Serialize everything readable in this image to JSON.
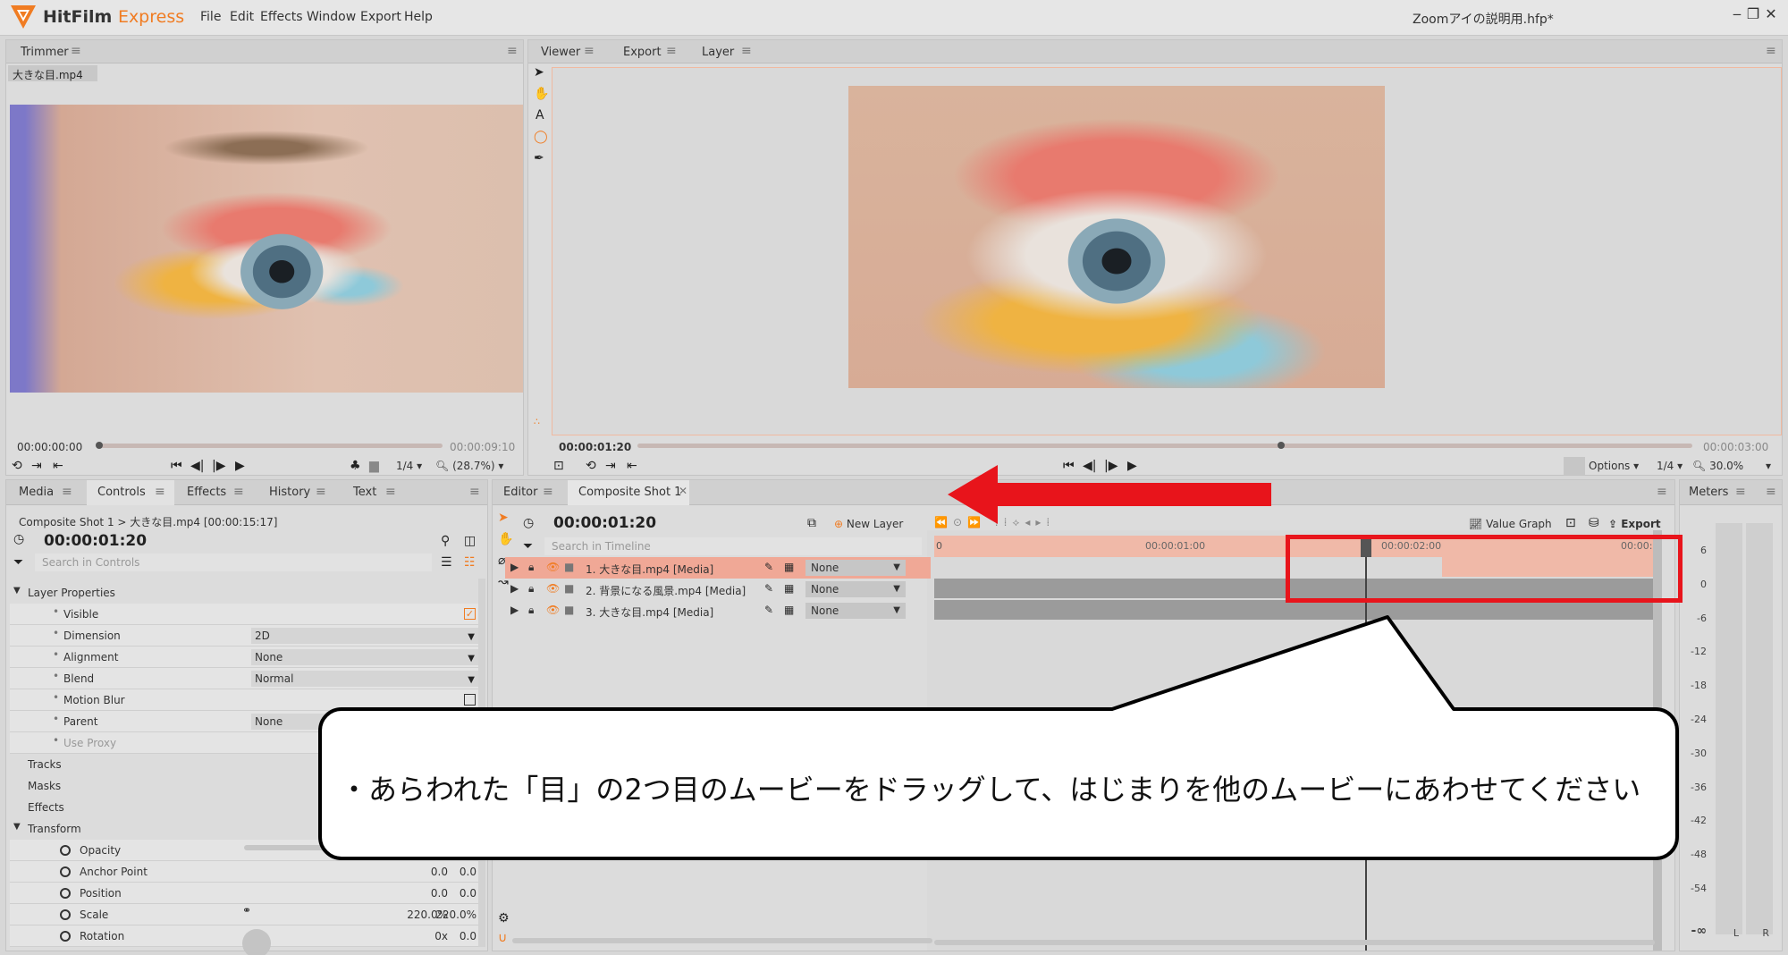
{
  "app": {
    "name": "HitFilm",
    "name_suffix": "Express",
    "file": "Zoomアイの説明用.hfp*"
  },
  "menu": [
    "File",
    "Edit",
    "Effects",
    "Window",
    "Export",
    "Help"
  ],
  "trimmer": {
    "tab": "Trimmer",
    "clip_tab": "大きな目.mp4",
    "time_current": "00:00:00:00",
    "time_end": "00:00:09:10",
    "resolution": "1/4",
    "zoom": "(28.7%)"
  },
  "viewer": {
    "tabs": [
      "Viewer",
      "Export",
      "Layer"
    ],
    "time_current": "00:00:01:20",
    "time_end": "00:00:03:00",
    "options": "Options",
    "resolution": "1/4",
    "zoom": "30.0%"
  },
  "left_panel": {
    "tabs": [
      "Media",
      "Controls",
      "Effects",
      "History",
      "Text"
    ],
    "breadcrumb": "Composite Shot 1 > 大きな目.mp4 [00:00:15:17]",
    "time": "00:00:01:20",
    "search_placeholder": "Search in Controls",
    "layer_properties_label": "Layer Properties",
    "properties": [
      {
        "label": "Visible",
        "value": "",
        "kind": "checkbox-on"
      },
      {
        "label": "Dimension",
        "value": "2D",
        "kind": "dropdown"
      },
      {
        "label": "Alignment",
        "value": "None",
        "kind": "dropdown"
      },
      {
        "label": "Blend",
        "value": "Normal",
        "kind": "dropdown"
      },
      {
        "label": "Motion Blur",
        "value": "",
        "kind": "checkbox-off"
      },
      {
        "label": "Parent",
        "value": "None",
        "kind": "dropdown"
      },
      {
        "label": "Use Proxy",
        "value": "",
        "kind": "disabled"
      }
    ],
    "sections": [
      "Tracks",
      "Masks",
      "Effects"
    ],
    "transform_label": "Transform",
    "transform": [
      {
        "label": "Opacity",
        "v1": "",
        "v2": ""
      },
      {
        "label": "Anchor Point",
        "v1": "0.0",
        "v2": "0.0"
      },
      {
        "label": "Position",
        "v1": "0.0",
        "v2": "0.0"
      },
      {
        "label": "Scale",
        "v1": "220.0%",
        "v2": "220.0%"
      },
      {
        "label": "Rotation",
        "v1": "0x",
        "v2": "0.0"
      }
    ]
  },
  "editor": {
    "tabs": [
      "Editor",
      "Composite Shot 1"
    ],
    "time": "00:00:01:20",
    "new_layer": "New Layer",
    "search_placeholder": "Search in Timeline",
    "value_graph": "Value Graph",
    "export": "Export",
    "ruler": [
      "0",
      "00:00:01:00",
      "00:00:02:00",
      "00:00:0"
    ],
    "layers": [
      {
        "name": "1. 大きな目.mp4 [Media]",
        "blend": "None",
        "selected": true
      },
      {
        "name": "2. 背景になる風景.mp4 [Media]",
        "blend": "None",
        "selected": false
      },
      {
        "name": "3. 大きな目.mp4 [Media]",
        "blend": "None",
        "selected": false
      }
    ]
  },
  "meters": {
    "tab": "Meters",
    "scale": [
      "6",
      "0",
      "-6",
      "-12",
      "-18",
      "-24",
      "-30",
      "-36",
      "-42",
      "-48",
      "-54",
      "-∞"
    ],
    "channels": [
      "L",
      "R"
    ]
  },
  "callout": {
    "text": "・あらわれた「目」の2つ目のムービーをドラッグして、はじまりを他のムービーにあわせてください"
  },
  "colors": {
    "accent": "#f07c22",
    "annotation_red": "#e8141b",
    "selected_layer": "#f0a896"
  }
}
